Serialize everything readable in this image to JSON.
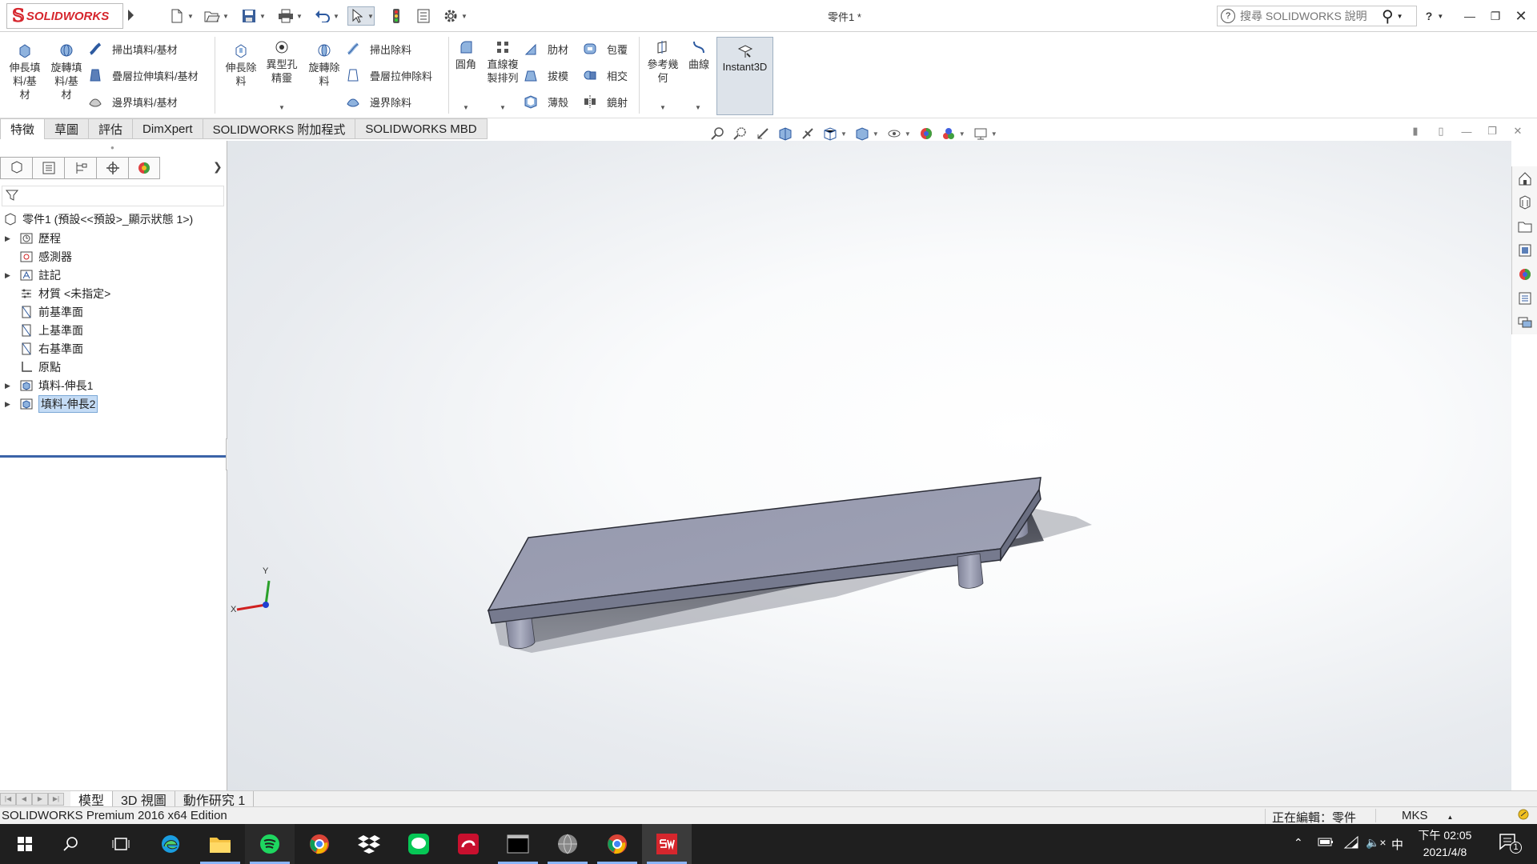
{
  "app": {
    "logo_text": "SOLIDWORKS",
    "document_title": "零件1 *",
    "help_placeholder": "搜尋 SOLIDWORKS 說明",
    "help_label": "?"
  },
  "ribbon": {
    "extrude_boss": "伸長填\n料/基\n材",
    "revolve_boss": "旋轉填\n料/基\n材",
    "swept_boss": "掃出填料/基材",
    "lofted_boss": "疊層拉伸填料/基材",
    "boundary_boss": "邊界填料/基材",
    "extrude_cut": "伸長除\n料",
    "hole_wizard": "異型孔\n精靈",
    "revolve_cut": "旋轉除\n料",
    "swept_cut": "掃出除料",
    "lofted_cut": "疊層拉伸除料",
    "boundary_cut": "邊界除料",
    "fillet": "圓角",
    "linear_pattern": "直線複\n製排列",
    "rib": "肋材",
    "draft": "拔模",
    "shell": "薄殼",
    "wrap": "包覆",
    "intersect": "相交",
    "mirror": "鏡射",
    "ref_geometry": "參考幾\n何",
    "curves": "曲線",
    "instant3d": "Instant3D"
  },
  "tabs": [
    "特徵",
    "草圖",
    "評估",
    "DimXpert",
    "SOLIDWORKS 附加程式",
    "SOLIDWORKS MBD"
  ],
  "tree": {
    "root": "零件1 (預設<<預設>_顯示狀態 1>)",
    "items": [
      {
        "label": "歷程",
        "expandable": true,
        "icon": "history-icon"
      },
      {
        "label": "感測器",
        "expandable": false,
        "icon": "sensor-icon"
      },
      {
        "label": "註記",
        "expandable": true,
        "icon": "annotation-icon"
      },
      {
        "label": "材質 <未指定>",
        "expandable": false,
        "icon": "material-icon"
      },
      {
        "label": "前基準面",
        "expandable": false,
        "icon": "plane-icon"
      },
      {
        "label": "上基準面",
        "expandable": false,
        "icon": "plane-icon"
      },
      {
        "label": "右基準面",
        "expandable": false,
        "icon": "plane-icon"
      },
      {
        "label": "原點",
        "expandable": false,
        "icon": "origin-icon"
      },
      {
        "label": "填料-伸長1",
        "expandable": true,
        "icon": "extrude-icon"
      },
      {
        "label": "填料-伸長2",
        "expandable": true,
        "icon": "extrude-icon",
        "selected": true
      }
    ]
  },
  "triad": {
    "x": "X",
    "y": "Y"
  },
  "bottom_tabs": [
    "模型",
    "3D 視圖",
    "動作研究 1"
  ],
  "status": {
    "edition": "SOLIDWORKS Premium 2016 x64 Edition",
    "editing": "正在編輯：零件",
    "units": "MKS"
  },
  "taskbar": {
    "time": "下午 02:05",
    "date": "2021/4/8",
    "ime": "中",
    "notification_count": "1"
  },
  "colors": {
    "brand": "#d6262d",
    "part_top": "#9a9db2",
    "part_side": "#6b6f82",
    "selection": "#c5dcf5"
  }
}
